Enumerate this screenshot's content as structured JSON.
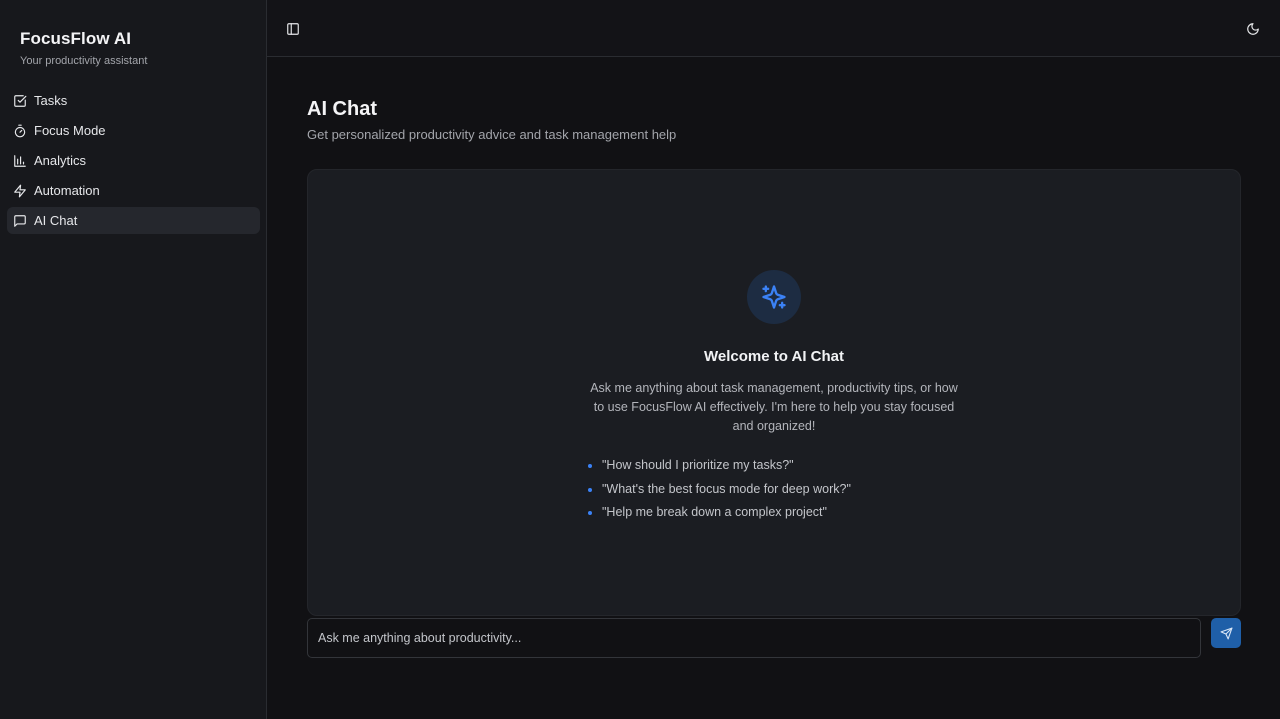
{
  "brand": {
    "title": "FocusFlow AI",
    "subtitle": "Your productivity assistant"
  },
  "sidebar": {
    "items": [
      {
        "label": "Tasks",
        "icon": "square-check-icon",
        "active": false
      },
      {
        "label": "Focus Mode",
        "icon": "timer-icon",
        "active": false
      },
      {
        "label": "Analytics",
        "icon": "bar-chart-icon",
        "active": false
      },
      {
        "label": "Automation",
        "icon": "zap-icon",
        "active": false
      },
      {
        "label": "AI Chat",
        "icon": "message-square-icon",
        "active": true
      }
    ]
  },
  "topbar": {
    "toggle_icon": "sidebar-toggle-icon",
    "theme_icon": "moon-icon"
  },
  "main": {
    "title": "AI Chat",
    "subtitle": "Get personalized productivity advice and task management help"
  },
  "welcome": {
    "icon": "sparkles-icon",
    "title": "Welcome to AI Chat",
    "text": "Ask me anything about task management, productivity tips, or how to use FocusFlow AI effectively. I'm here to help you stay focused and organized!",
    "suggestions": [
      "\"How should I prioritize my tasks?\"",
      "\"What's the best focus mode for deep work?\"",
      "\"Help me break down a complex project\""
    ]
  },
  "input": {
    "placeholder": "Ask me anything about productivity...",
    "value": ""
  },
  "colors": {
    "accent": "#3b82f6",
    "send_button": "#1f5fa8",
    "background": "#111114",
    "sidebar": "#17181c",
    "panel": "#1b1d22"
  }
}
